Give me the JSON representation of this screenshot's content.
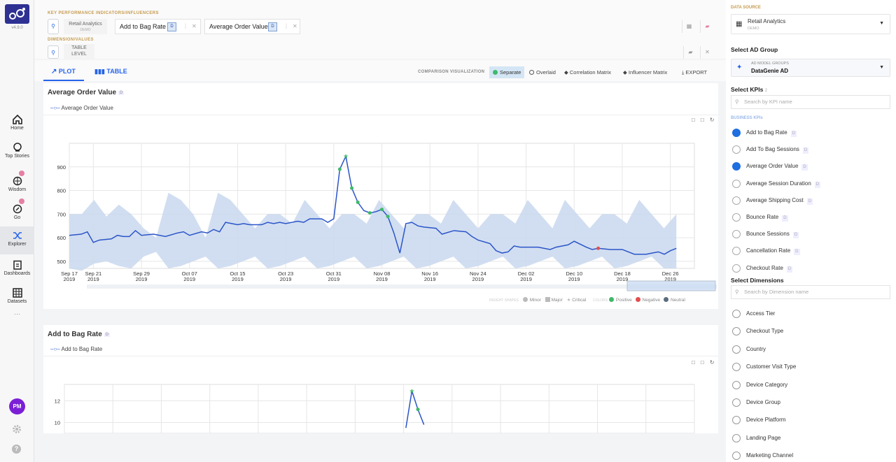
{
  "app": {
    "version": "v4.9.0",
    "colors": {
      "accent": "#2563eb",
      "brand": "#2e3192",
      "band": "#c9d8ee",
      "positive": "#3fb96a",
      "negative": "#e44d4d",
      "neutral": "#5b6c7d"
    }
  },
  "nav": {
    "items": [
      {
        "label": "Home",
        "icon": "home-icon"
      },
      {
        "label": "Top Stories",
        "icon": "search-stories-icon"
      },
      {
        "label": "Wisdom",
        "icon": "brain-icon"
      },
      {
        "label": "Go",
        "icon": "rocket-icon"
      },
      {
        "label": "Explorer",
        "icon": "shuffle-icon"
      },
      {
        "label": "Dashboards",
        "icon": "clipboard-icon"
      },
      {
        "label": "Datasets",
        "icon": "grid-icon"
      }
    ],
    "more": "···",
    "avatar": "PM"
  },
  "selector": {
    "kpi_heading": "KEY PERFORMANCE INDICATORS/INFLUENCERS",
    "source_chip": "Retail Analytics",
    "source_sub": "DEMO",
    "kpis": [
      {
        "label": "Add to Bag Rate",
        "tag": "D"
      },
      {
        "label": "Average Order Value",
        "tag": "D"
      }
    ],
    "dim_heading": "DIMENSION/VALUES",
    "level_chip_1": "TABLE",
    "level_chip_2": "LEVEL"
  },
  "views": {
    "plot": "PLOT",
    "table": "TABLE",
    "comparison_label": "COMPARISON VISUALIZATION",
    "separate": "Separate",
    "overlaid": "Overlaid",
    "correlation": "Correlation Matrix",
    "influencer": "Influencer Matrix",
    "export": "EXPORT"
  },
  "chart1": {
    "title": "Average Order Value",
    "title_tag": "D",
    "legend": "Average Order Value",
    "insight_label": "INSIGHT SHAPES",
    "minor": "Minor",
    "major": "Major",
    "critical": "Critical",
    "colors_label": "COLORS",
    "positive": "Positive",
    "negative": "Negative",
    "neutral": "Neutral"
  },
  "chart2": {
    "title": "Add to Bag Rate",
    "title_tag": "D",
    "legend": "Add to Bag Rate"
  },
  "chart_data": [
    {
      "type": "line",
      "title": "Average Order Value",
      "ylim": [
        470,
        1000
      ],
      "yticks": [
        500,
        600,
        700,
        800,
        900
      ],
      "x_ticks": [
        [
          "Sep 17",
          "2019"
        ],
        [
          "Sep 21",
          "2019"
        ],
        [
          "Sep 29",
          "2019"
        ],
        [
          "Oct 07",
          "2019"
        ],
        [
          "Oct 15",
          "2019"
        ],
        [
          "Oct 23",
          "2019"
        ],
        [
          "Oct 31",
          "2019"
        ],
        [
          "Nov 08",
          "2019"
        ],
        [
          "Nov 16",
          "2019"
        ],
        [
          "Nov 24",
          "2019"
        ],
        [
          "Dec 02",
          "2019"
        ],
        [
          "Dec 10",
          "2019"
        ],
        [
          "Dec 18",
          "2019"
        ],
        [
          "Dec 26",
          "2019"
        ]
      ],
      "x_tick_days": [
        0,
        4,
        12,
        20,
        28,
        36,
        44,
        52,
        60,
        68,
        76,
        84,
        92,
        100
      ],
      "series": [
        {
          "name": "Average Order Value",
          "days": [
            0,
            2,
            3,
            4,
            5,
            7,
            8,
            9,
            10,
            11,
            12,
            14,
            16,
            18,
            19,
            20,
            22,
            23,
            24,
            25,
            26,
            28,
            29,
            30,
            32,
            33,
            34,
            35,
            36,
            38,
            39,
            40,
            42,
            43,
            44,
            45,
            46,
            47,
            48,
            49,
            50,
            51,
            52,
            53,
            54,
            55,
            56,
            57,
            58,
            59,
            61,
            62,
            64,
            66,
            67,
            68,
            70,
            71,
            72,
            73,
            74,
            75,
            76,
            78,
            80,
            81,
            83,
            84,
            86,
            87,
            88,
            90,
            92,
            94,
            96,
            97,
            98,
            99,
            100,
            101
          ],
          "values": [
            610,
            615,
            625,
            580,
            590,
            595,
            610,
            605,
            605,
            630,
            610,
            615,
            605,
            620,
            625,
            610,
            625,
            620,
            635,
            625,
            665,
            655,
            660,
            655,
            655,
            665,
            660,
            665,
            660,
            670,
            665,
            680,
            680,
            665,
            680,
            890,
            945,
            810,
            750,
            715,
            705,
            710,
            720,
            690,
            620,
            535,
            660,
            665,
            650,
            645,
            640,
            615,
            630,
            625,
            605,
            590,
            575,
            545,
            535,
            540,
            565,
            560,
            560,
            560,
            550,
            560,
            570,
            585,
            560,
            550,
            555,
            550,
            550,
            530,
            530,
            535,
            540,
            530,
            545,
            555,
            560,
            570,
            545,
            580
          ]
        }
      ],
      "band_upper": [
        700,
        700,
        760,
        690,
        740,
        700,
        640,
        600,
        790,
        760,
        700,
        600,
        790,
        760,
        700,
        640,
        700,
        700,
        660,
        760,
        700,
        640,
        700,
        700,
        660,
        760,
        700,
        640,
        700,
        700,
        660,
        760,
        700,
        640,
        700,
        700,
        660,
        760,
        700,
        640,
        760,
        700,
        640,
        700,
        700,
        660,
        760,
        700,
        640,
        700
      ],
      "band_lower": [
        470,
        460,
        490,
        500,
        480,
        470,
        520,
        540,
        470,
        480,
        500,
        520,
        470,
        480,
        500,
        520,
        470,
        480,
        500,
        520,
        470,
        480,
        500,
        520,
        470,
        480,
        500,
        520,
        470,
        480,
        500,
        520,
        470,
        480,
        500,
        520,
        470,
        480,
        500,
        520,
        470,
        480,
        500,
        520,
        470,
        480,
        500,
        520,
        470,
        470
      ],
      "annotations": {
        "critical": [
          46
        ],
        "positive": [
          45,
          47,
          48,
          50,
          52,
          53
        ],
        "negative": [
          88
        ]
      }
    },
    {
      "type": "line",
      "title": "Add to Bag Rate",
      "ylim": [
        9,
        13.5
      ],
      "yticks": [
        10,
        12
      ],
      "series": [
        {
          "name": "Add to Bag Rate",
          "days": [
            56,
            57,
            58,
            59
          ],
          "values": [
            9.5,
            12.9,
            11.2,
            9.8
          ]
        }
      ]
    }
  ],
  "right": {
    "data_source_heading": "DATA SOURCE",
    "data_source": "Retail Analytics",
    "data_source_sub": "DEMO",
    "ad_group_heading": "Select AD Group",
    "ad_group_sub": "AD MODEL GROUPS",
    "ad_group": "DataGenie AD",
    "kpis_heading": "Select KPIs",
    "kpis_count": "2",
    "kpi_search": "Search by KPI name",
    "business_kpis": "BUSINESS KPIs",
    "kpis": [
      {
        "label": "Add to Bag Rate",
        "tag": "D",
        "checked": true
      },
      {
        "label": "Add To Bag Sessions",
        "tag": "D",
        "checked": false
      },
      {
        "label": "Average Order Value",
        "tag": "D",
        "checked": true
      },
      {
        "label": "Average Session Duration",
        "tag": "D",
        "checked": false
      },
      {
        "label": "Average Shipping Cost",
        "tag": "D",
        "checked": false
      },
      {
        "label": "Bounce Rate",
        "tag": "D",
        "checked": false
      },
      {
        "label": "Bounce Sessions",
        "tag": "D",
        "checked": false
      },
      {
        "label": "Cancellation Rate",
        "tag": "D",
        "checked": false
      },
      {
        "label": "Checkout Rate",
        "tag": "D",
        "checked": false
      }
    ],
    "dims_heading": "Select Dimensions",
    "dim_search": "Search by Dimension name",
    "dims": [
      "Access Tier",
      "Checkout Type",
      "Country",
      "Customer Visit Type",
      "Device Category",
      "Device Group",
      "Device Platform",
      "Landing Page",
      "Marketing Channel"
    ]
  }
}
